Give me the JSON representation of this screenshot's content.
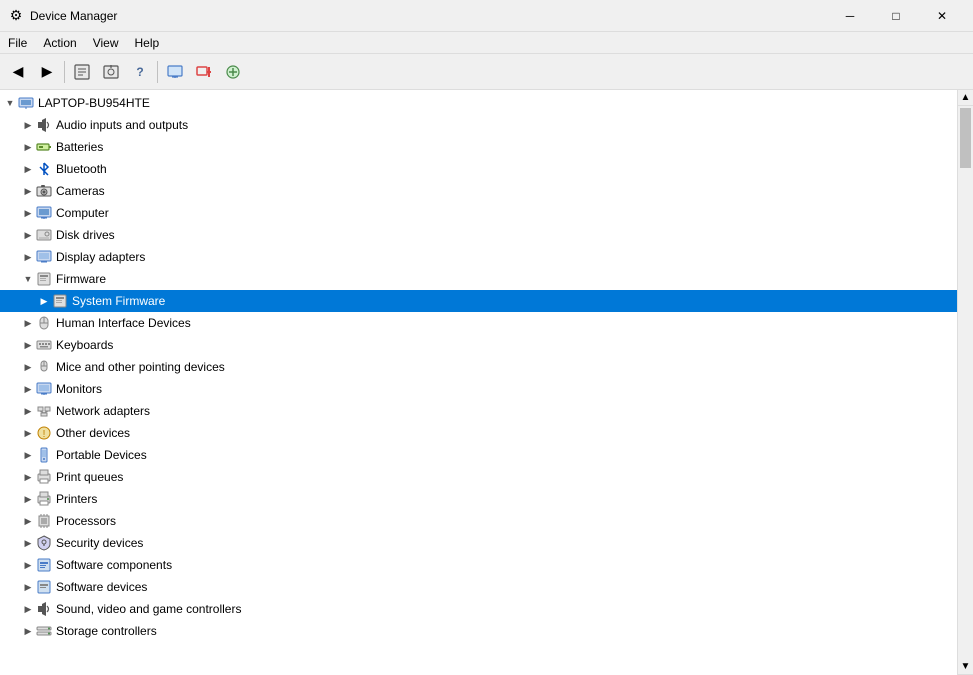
{
  "window": {
    "title": "Device Manager",
    "icon": "💻"
  },
  "title_bar": {
    "title": "Device Manager",
    "minimize_label": "─",
    "maximize_label": "□",
    "close_label": "✕"
  },
  "menu_bar": {
    "items": [
      {
        "id": "file",
        "label": "File"
      },
      {
        "id": "action",
        "label": "Action"
      },
      {
        "id": "view",
        "label": "View"
      },
      {
        "id": "help",
        "label": "Help"
      }
    ]
  },
  "toolbar": {
    "buttons": [
      {
        "id": "back",
        "icon": "◀",
        "label": "Back"
      },
      {
        "id": "forward",
        "icon": "▶",
        "label": "Forward"
      },
      {
        "id": "properties",
        "icon": "📋",
        "label": "Properties"
      },
      {
        "id": "update-driver",
        "icon": "🔄",
        "label": "Update Driver"
      },
      {
        "id": "help",
        "icon": "❓",
        "label": "Help"
      },
      {
        "id": "monitor",
        "icon": "🖥",
        "label": "Monitor"
      }
    ]
  },
  "tree": {
    "root": {
      "label": "LAPTOP-BU954HTE",
      "expanded": true
    },
    "items": [
      {
        "id": "audio",
        "label": "Audio inputs and outputs",
        "icon": "🔊",
        "indent": 1,
        "expanded": false
      },
      {
        "id": "batteries",
        "label": "Batteries",
        "icon": "🔋",
        "indent": 1,
        "expanded": false
      },
      {
        "id": "bluetooth",
        "label": "Bluetooth",
        "icon": "🔵",
        "indent": 1,
        "expanded": false
      },
      {
        "id": "cameras",
        "label": "Cameras",
        "icon": "📷",
        "indent": 1,
        "expanded": false
      },
      {
        "id": "computer",
        "label": "Computer",
        "icon": "🖥",
        "indent": 1,
        "expanded": false
      },
      {
        "id": "disk-drives",
        "label": "Disk drives",
        "icon": "💾",
        "indent": 1,
        "expanded": false
      },
      {
        "id": "display-adapters",
        "label": "Display adapters",
        "icon": "🖥",
        "indent": 1,
        "expanded": false
      },
      {
        "id": "firmware",
        "label": "Firmware",
        "icon": "📦",
        "indent": 1,
        "expanded": true
      },
      {
        "id": "system-firmware",
        "label": "System Firmware",
        "icon": "📦",
        "indent": 2,
        "expanded": false,
        "selected": true
      },
      {
        "id": "hid",
        "label": "Human Interface Devices",
        "icon": "🖱",
        "indent": 1,
        "expanded": false
      },
      {
        "id": "keyboards",
        "label": "Keyboards",
        "icon": "⌨",
        "indent": 1,
        "expanded": false
      },
      {
        "id": "mice",
        "label": "Mice and other pointing devices",
        "icon": "🖱",
        "indent": 1,
        "expanded": false
      },
      {
        "id": "monitors",
        "label": "Monitors",
        "icon": "🖥",
        "indent": 1,
        "expanded": false
      },
      {
        "id": "network-adapters",
        "label": "Network adapters",
        "icon": "📡",
        "indent": 1,
        "expanded": false
      },
      {
        "id": "other-devices",
        "label": "Other devices",
        "icon": "⚙",
        "indent": 1,
        "expanded": false
      },
      {
        "id": "portable-devices",
        "label": "Portable Devices",
        "icon": "📱",
        "indent": 1,
        "expanded": false
      },
      {
        "id": "print-queues",
        "label": "Print queues",
        "icon": "🖨",
        "indent": 1,
        "expanded": false
      },
      {
        "id": "printers",
        "label": "Printers",
        "icon": "🖨",
        "indent": 1,
        "expanded": false
      },
      {
        "id": "processors",
        "label": "Processors",
        "icon": "⚙",
        "indent": 1,
        "expanded": false
      },
      {
        "id": "security-devices",
        "label": "Security devices",
        "icon": "🔒",
        "indent": 1,
        "expanded": false
      },
      {
        "id": "software-components",
        "label": "Software components",
        "icon": "📦",
        "indent": 1,
        "expanded": false
      },
      {
        "id": "software-devices",
        "label": "Software devices",
        "icon": "📦",
        "indent": 1,
        "expanded": false
      },
      {
        "id": "sound-video",
        "label": "Sound, video and game controllers",
        "icon": "🔊",
        "indent": 1,
        "expanded": false
      },
      {
        "id": "storage-controllers",
        "label": "Storage controllers",
        "icon": "💾",
        "indent": 1,
        "expanded": false
      }
    ]
  }
}
